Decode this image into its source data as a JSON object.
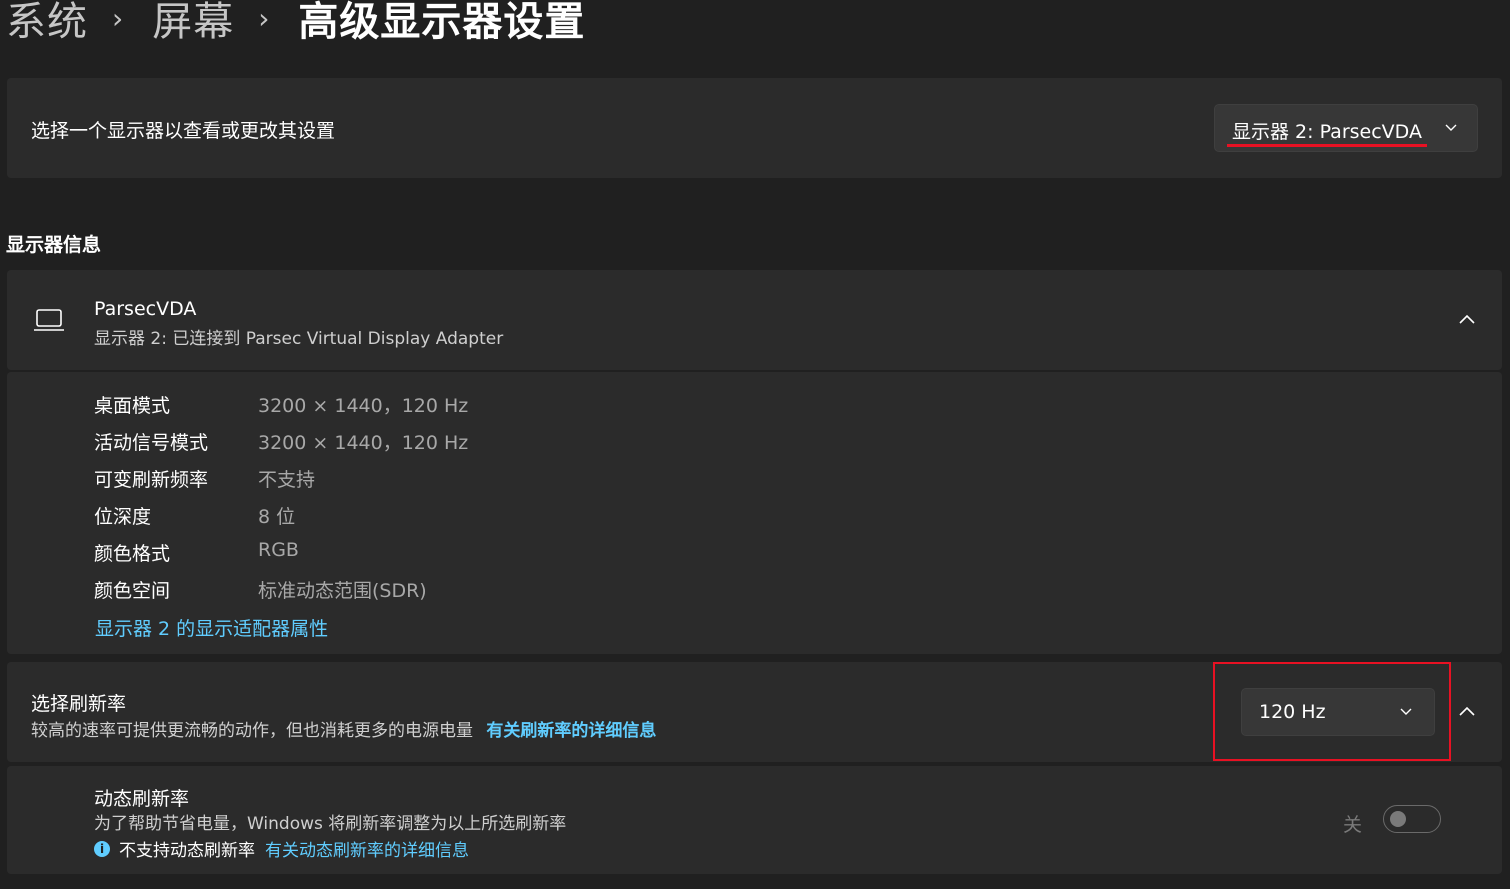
{
  "breadcrumb": {
    "items": [
      "系统",
      "屏幕"
    ],
    "separator": "›",
    "current": "高级显示器设置"
  },
  "display_selector": {
    "label": "选择一个显示器以查看或更改其设置",
    "selected": "显示器 2: ParsecVDA"
  },
  "display_info": {
    "section_title": "显示器信息",
    "name": "ParsecVDA",
    "subtitle": "显示器 2: 已连接到 Parsec Virtual Display Adapter",
    "rows": [
      {
        "key": "桌面模式",
        "value": "3200 × 1440，120 Hz"
      },
      {
        "key": "活动信号模式",
        "value": "3200 × 1440，120 Hz"
      },
      {
        "key": "可变刷新频率",
        "value": "不支持"
      },
      {
        "key": "位深度",
        "value": "8 位"
      },
      {
        "key": "颜色格式",
        "value": "RGB"
      },
      {
        "key": "颜色空间",
        "value": "标准动态范围(SDR)"
      }
    ],
    "adapter_link": "显示器 2 的显示适配器属性"
  },
  "refresh_rate": {
    "title": "选择刷新率",
    "description": "较高的速率可提供更流畅的动作，但也消耗更多的电源电量",
    "link": "有关刷新率的详细信息",
    "selected": "120 Hz"
  },
  "dynamic_refresh": {
    "title": "动态刷新率",
    "description": "为了帮助节省电量，Windows 将刷新率调整为以上所选刷新率",
    "note": "不支持动态刷新率",
    "link": "有关动态刷新率的详细信息",
    "toggle_label": "关",
    "toggle_on": false
  },
  "colors": {
    "background": "#202020",
    "card": "#2b2b2b",
    "accent": "#60cdff",
    "highlight": "#e81123"
  }
}
